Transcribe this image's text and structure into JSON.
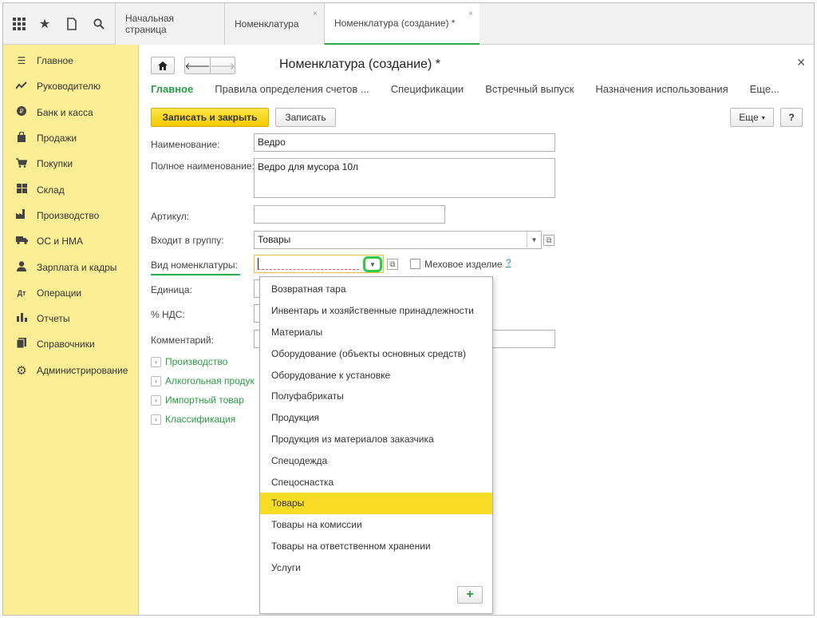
{
  "topbar": {
    "tabs": [
      {
        "label": "Начальная страница",
        "closable": false,
        "active": false
      },
      {
        "label": "Номенклатура",
        "closable": true,
        "active": false
      },
      {
        "label": "Номенклатура (создание) *",
        "closable": true,
        "active": true
      }
    ]
  },
  "sidebar": {
    "items": [
      {
        "label": "Главное",
        "icon": "menu-icon"
      },
      {
        "label": "Руководителю",
        "icon": "trend-icon"
      },
      {
        "label": "Банк и касса",
        "icon": "coin-icon"
      },
      {
        "label": "Продажи",
        "icon": "bag-icon"
      },
      {
        "label": "Покупки",
        "icon": "cart-icon"
      },
      {
        "label": "Склад",
        "icon": "warehouse-icon"
      },
      {
        "label": "Производство",
        "icon": "factory-icon"
      },
      {
        "label": "ОС и НМА",
        "icon": "truck-icon"
      },
      {
        "label": "Зарплата и кадры",
        "icon": "person-icon"
      },
      {
        "label": "Операции",
        "icon": "operations-icon"
      },
      {
        "label": "Отчеты",
        "icon": "chart-icon"
      },
      {
        "label": "Справочники",
        "icon": "book-icon"
      },
      {
        "label": "Администрирование",
        "icon": "gear-icon"
      }
    ]
  },
  "form": {
    "title": "Номенклатура (создание) *",
    "subtabs": [
      "Главное",
      "Правила определения счетов ...",
      "Спецификации",
      "Встречный выпуск",
      "Назначения использования",
      "Еще..."
    ],
    "save_close_label": "Записать и закрыть",
    "save_label": "Записать",
    "more_label": "Еще",
    "help_label": "?",
    "name_label": "Наименование:",
    "name_value": "Ведро",
    "full_name_label": "Полное наименование:",
    "full_name_value": "Ведро для мусора 10л",
    "article_label": "Артикул:",
    "article_value": "",
    "group_label": "Входит в группу:",
    "group_value": "Товары",
    "kind_label": "Вид номенклатуры:",
    "kind_value": "",
    "fur_label": "Меховое изделие",
    "fur_help": "?",
    "unit_label": "Единица:",
    "vat_label": "% НДС:",
    "comment_label": "Комментарий:",
    "groups": [
      "Производство",
      "Алкогольная продук",
      "Импортный товар",
      "Классификация"
    ]
  },
  "dropdown": {
    "items": [
      "Возвратная тара",
      "Инвентарь и хозяйственные принадлежности",
      "Материалы",
      "Оборудование (объекты основных средств)",
      "Оборудование к установке",
      "Полуфабрикаты",
      "Продукция",
      "Продукция из материалов заказчика",
      "Спецодежда",
      "Спецоснастка",
      "Товары",
      "Товары на комиссии",
      "Товары на ответственном хранении",
      "Услуги"
    ],
    "selected": "Товары",
    "add_label": "+"
  },
  "colors": {
    "accent_green": "#2aa84a",
    "sidebar_bg": "#fbee95",
    "selected_bg": "#f9dc25",
    "primary_btn": "#f5c900"
  }
}
